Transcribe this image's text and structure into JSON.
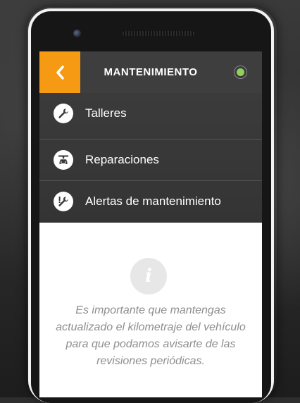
{
  "header": {
    "title": "MANTENIMIENTO",
    "back_icon": "chevron-left-icon",
    "status_icon": "status-dot-icon",
    "status_color": "#8fd15a",
    "accent_color": "#f59a12"
  },
  "menu": {
    "items": [
      {
        "label": "Talleres",
        "icon": "wrench-icon"
      },
      {
        "label": "Reparaciones",
        "icon": "car-service-icon"
      },
      {
        "label": "Alertas de mantenimiento",
        "icon": "wrench-alert-icon"
      }
    ]
  },
  "info": {
    "icon": "info-icon",
    "icon_glyph": "i",
    "message": "Es importante que mantengas actualizado el kilometraje del vehículo para que podamos avisarte de las revisiones periódicas."
  }
}
